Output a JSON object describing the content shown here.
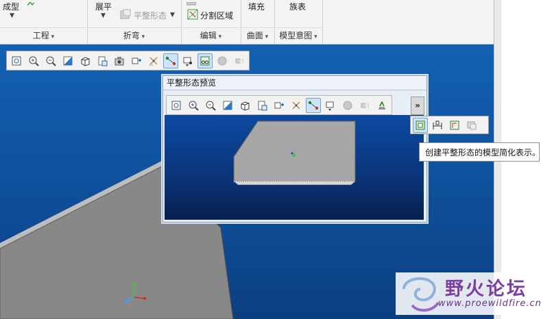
{
  "ribbon": {
    "groups": {
      "engineering": {
        "top_label": "成型",
        "name": "工程"
      },
      "bend": {
        "unbend_label": "展平",
        "flat_state_label": "平整形态",
        "name": "折弯"
      },
      "edit": {
        "split_region_label": "分割区域",
        "name": "编辑"
      },
      "surface": {
        "fill_label": "填充",
        "name": "曲面"
      },
      "model_intent": {
        "family_table_label": "族表",
        "name": "模型意图"
      }
    }
  },
  "graphics_toolbar": {
    "icons": [
      "refit-icon",
      "zoom-in-icon",
      "zoom-out-icon",
      "repaint-icon",
      "display-style-icon",
      "saved-views-icon",
      "view-manager-icon",
      "named-view-icon",
      "datum-display-icon",
      "spin-center-icon",
      "annotation-icon",
      "perspective-icon",
      "appearance-icon",
      "section-icon"
    ]
  },
  "preview": {
    "title": "平整形态预览",
    "expand_label": "»",
    "icons": [
      "refit-icon",
      "zoom-in-icon",
      "zoom-out-icon",
      "repaint-icon",
      "display-style-icon",
      "saved-views-icon",
      "view-manager-icon",
      "datum-display-icon",
      "spin-center-icon",
      "annotation-icon",
      "appearance-icon",
      "section-icon",
      "unbend-view-icon"
    ]
  },
  "flyout": {
    "icons": [
      "simplified-rep-icon",
      "dimension-icon",
      "flat-pattern-icon",
      "layer-icon"
    ]
  },
  "tooltip": {
    "text": "创建平整形态的模型简化表示。"
  },
  "watermark": {
    "title": "野火论坛",
    "url": "www.proewildfire.cn"
  },
  "colors": {
    "viewport_blue": "#1361b3",
    "part_gray": "#8a8a8a",
    "toolbar_bg": "#f2f2f2",
    "watermark_purple": "#7a3fa0"
  }
}
